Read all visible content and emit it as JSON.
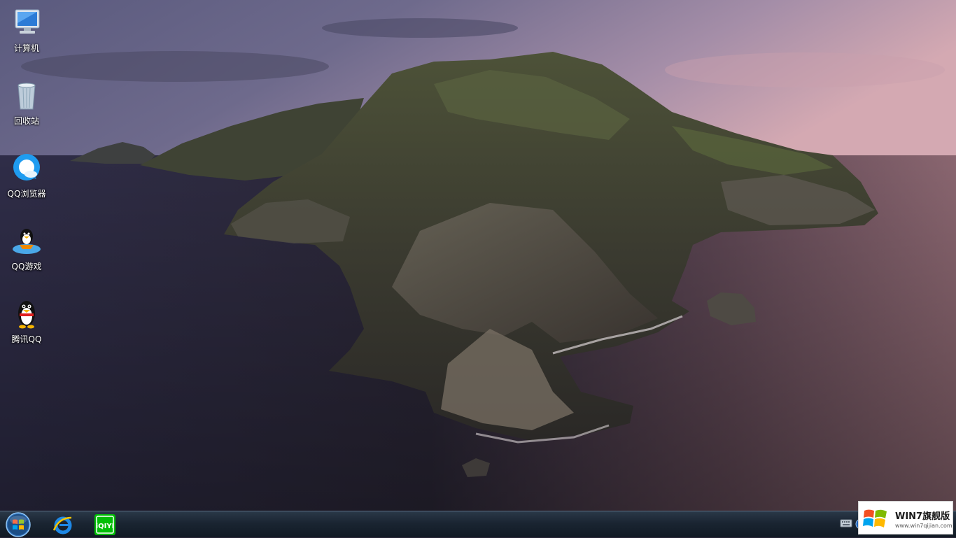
{
  "desktop": {
    "icons": [
      {
        "label": "计算机",
        "icon": "computer-icon"
      },
      {
        "label": "回收站",
        "icon": "recycle-bin-icon"
      },
      {
        "label": "QQ浏览器",
        "icon": "qq-browser-icon"
      },
      {
        "label": "QQ游戏",
        "icon": "qq-game-icon"
      },
      {
        "label": "腾讯QQ",
        "icon": "qq-penguin-icon"
      }
    ]
  },
  "taskbar": {
    "start_icon": "windows-orb-icon",
    "pinned": [
      {
        "icon": "internet-explorer-icon"
      },
      {
        "icon": "iqiyi-icon",
        "label": "iQIYI"
      }
    ],
    "tray": [
      {
        "icon": "keyboard-icon"
      },
      {
        "icon": "help-icon"
      }
    ]
  },
  "watermark": {
    "title": "WIN7旗舰版",
    "url": "www.win7qijian.com"
  },
  "colors": {
    "taskbar": "#1a2532",
    "iqiyi_green": "#00be06",
    "ie_blue": "#1e88e5"
  }
}
